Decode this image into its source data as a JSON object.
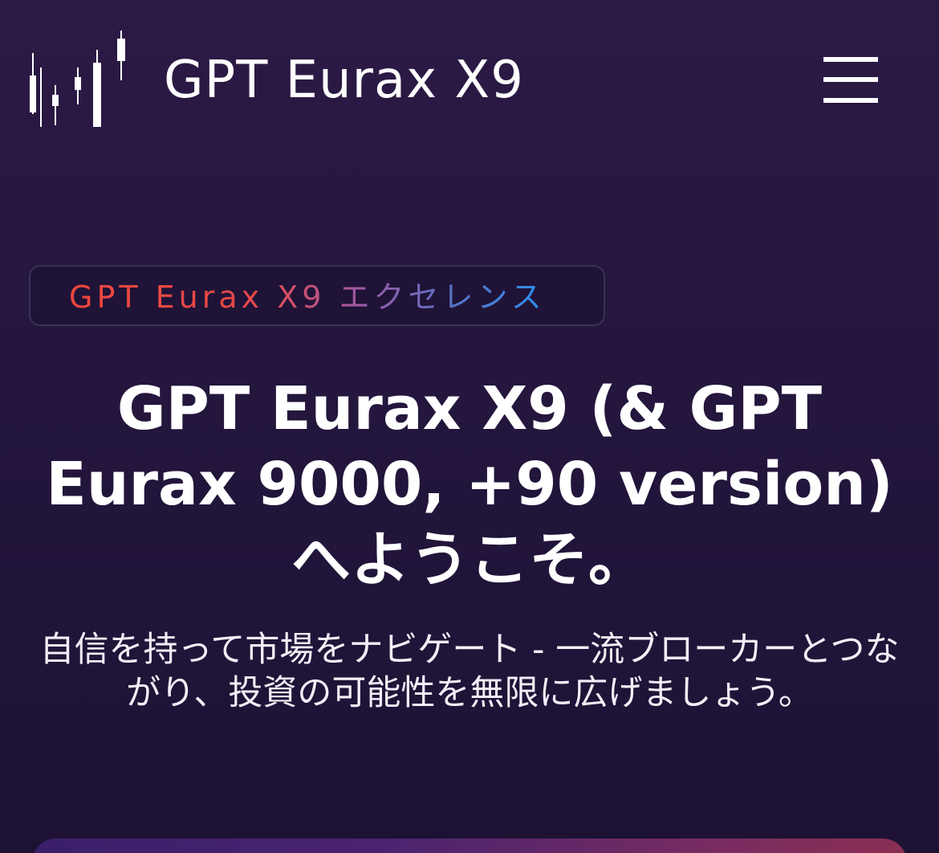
{
  "header": {
    "brand": "GPT Eurax X9",
    "logo_icon": "candlestick-chart-icon",
    "menu_icon": "hamburger-menu-icon"
  },
  "hero": {
    "badge": "GPT Eurax X9 エクセレンス",
    "title": "GPT Eurax X9 (& GPT Eurax 9000, +90 version) へようこそ。",
    "subtitle": "自信を持って市場をナビゲート - 一流ブローカーとつながり、投資の可能性を無限に広げましょう。"
  },
  "colors": {
    "background": "#2b1a45",
    "text": "#ffffff",
    "badge_gradient_start": "#f0463c",
    "badge_gradient_end": "#2e8ef0",
    "badge_border": "#3a3157"
  }
}
